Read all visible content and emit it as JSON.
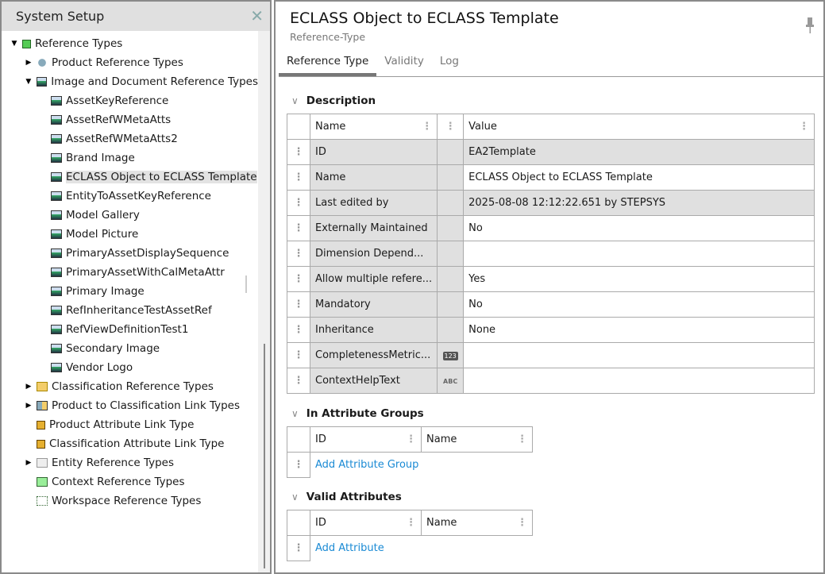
{
  "left": {
    "title": "System Setup",
    "tree": [
      {
        "label": "Reference Types",
        "level": 0,
        "exp": "down",
        "icon": "ref"
      },
      {
        "label": "Product Reference Types",
        "level": 1,
        "exp": "right",
        "icon": "prod"
      },
      {
        "label": "Image and Document Reference Types",
        "level": 1,
        "exp": "down",
        "icon": "img"
      },
      {
        "label": "AssetKeyReference",
        "level": 2,
        "exp": "",
        "icon": "img"
      },
      {
        "label": "AssetRefWMetaAtts",
        "level": 2,
        "exp": "",
        "icon": "img"
      },
      {
        "label": "AssetRefWMetaAtts2",
        "level": 2,
        "exp": "",
        "icon": "img"
      },
      {
        "label": "Brand Image",
        "level": 2,
        "exp": "",
        "icon": "img"
      },
      {
        "label": "ECLASS Object to ECLASS Template",
        "level": 2,
        "exp": "",
        "icon": "img",
        "selected": true
      },
      {
        "label": "EntityToAssetKeyReference",
        "level": 2,
        "exp": "",
        "icon": "img"
      },
      {
        "label": "Model Gallery",
        "level": 2,
        "exp": "",
        "icon": "img"
      },
      {
        "label": "Model Picture",
        "level": 2,
        "exp": "",
        "icon": "img"
      },
      {
        "label": "PrimaryAssetDisplaySequence",
        "level": 2,
        "exp": "",
        "icon": "img"
      },
      {
        "label": "PrimaryAssetWithCalMetaAttr",
        "level": 2,
        "exp": "",
        "icon": "img"
      },
      {
        "label": "Primary Image",
        "level": 2,
        "exp": "",
        "icon": "img"
      },
      {
        "label": "RefInheritanceTestAssetRef",
        "level": 2,
        "exp": "",
        "icon": "img"
      },
      {
        "label": "RefViewDefinitionTest1",
        "level": 2,
        "exp": "",
        "icon": "img"
      },
      {
        "label": "Secondary Image",
        "level": 2,
        "exp": "",
        "icon": "img"
      },
      {
        "label": "Vendor Logo",
        "level": 2,
        "exp": "",
        "icon": "img"
      },
      {
        "label": "Classification Reference Types",
        "level": 1,
        "exp": "right",
        "icon": "folder"
      },
      {
        "label": "Product to Classification Link Types",
        "level": 1,
        "exp": "right",
        "icon": "pc"
      },
      {
        "label": "Product Attribute Link Type",
        "level": 1,
        "exp": "",
        "icon": "link"
      },
      {
        "label": "Classification Attribute Link Type",
        "level": 1,
        "exp": "",
        "icon": "link"
      },
      {
        "label": "Entity Reference Types",
        "level": 1,
        "exp": "right",
        "icon": "ent"
      },
      {
        "label": "Context Reference Types",
        "level": 1,
        "exp": "",
        "icon": "ctx"
      },
      {
        "label": "Workspace Reference Types",
        "level": 1,
        "exp": "",
        "icon": "ws"
      }
    ]
  },
  "right": {
    "title": "ECLASS Object to ECLASS Template",
    "subtitle": "Reference-Type",
    "tabs": [
      "Reference Type",
      "Validity",
      "Log"
    ],
    "description": {
      "title": "Description",
      "col_name": "Name",
      "col_value": "Value",
      "rows": [
        {
          "name": "ID",
          "value": "EA2Template",
          "readonly": true,
          "badge": ""
        },
        {
          "name": "Name",
          "value": "ECLASS Object to ECLASS Template",
          "readonly": false,
          "badge": ""
        },
        {
          "name": "Last edited by",
          "value": "2025-08-08 12:12:22.651 by STEPSYS",
          "readonly": true,
          "badge": ""
        },
        {
          "name": "Externally Maintained",
          "value": "No",
          "readonly": false,
          "badge": ""
        },
        {
          "name": "Dimension Depend...",
          "value": "",
          "readonly": false,
          "badge": ""
        },
        {
          "name": "Allow multiple refere...",
          "value": "Yes",
          "readonly": false,
          "badge": ""
        },
        {
          "name": "Mandatory",
          "value": "No",
          "readonly": false,
          "badge": ""
        },
        {
          "name": "Inheritance",
          "value": "None",
          "readonly": false,
          "badge": ""
        },
        {
          "name": "CompletenessMetric...",
          "value": "",
          "readonly": false,
          "badge": "123"
        },
        {
          "name": "ContextHelpText",
          "value": "",
          "readonly": false,
          "badge": "ABC"
        }
      ]
    },
    "groups": {
      "title": "In Attribute Groups",
      "col_id": "ID",
      "col_name": "Name",
      "add": "Add Attribute Group"
    },
    "valid": {
      "title": "Valid Attributes",
      "col_id": "ID",
      "col_name": "Name",
      "add": "Add Attribute"
    }
  }
}
